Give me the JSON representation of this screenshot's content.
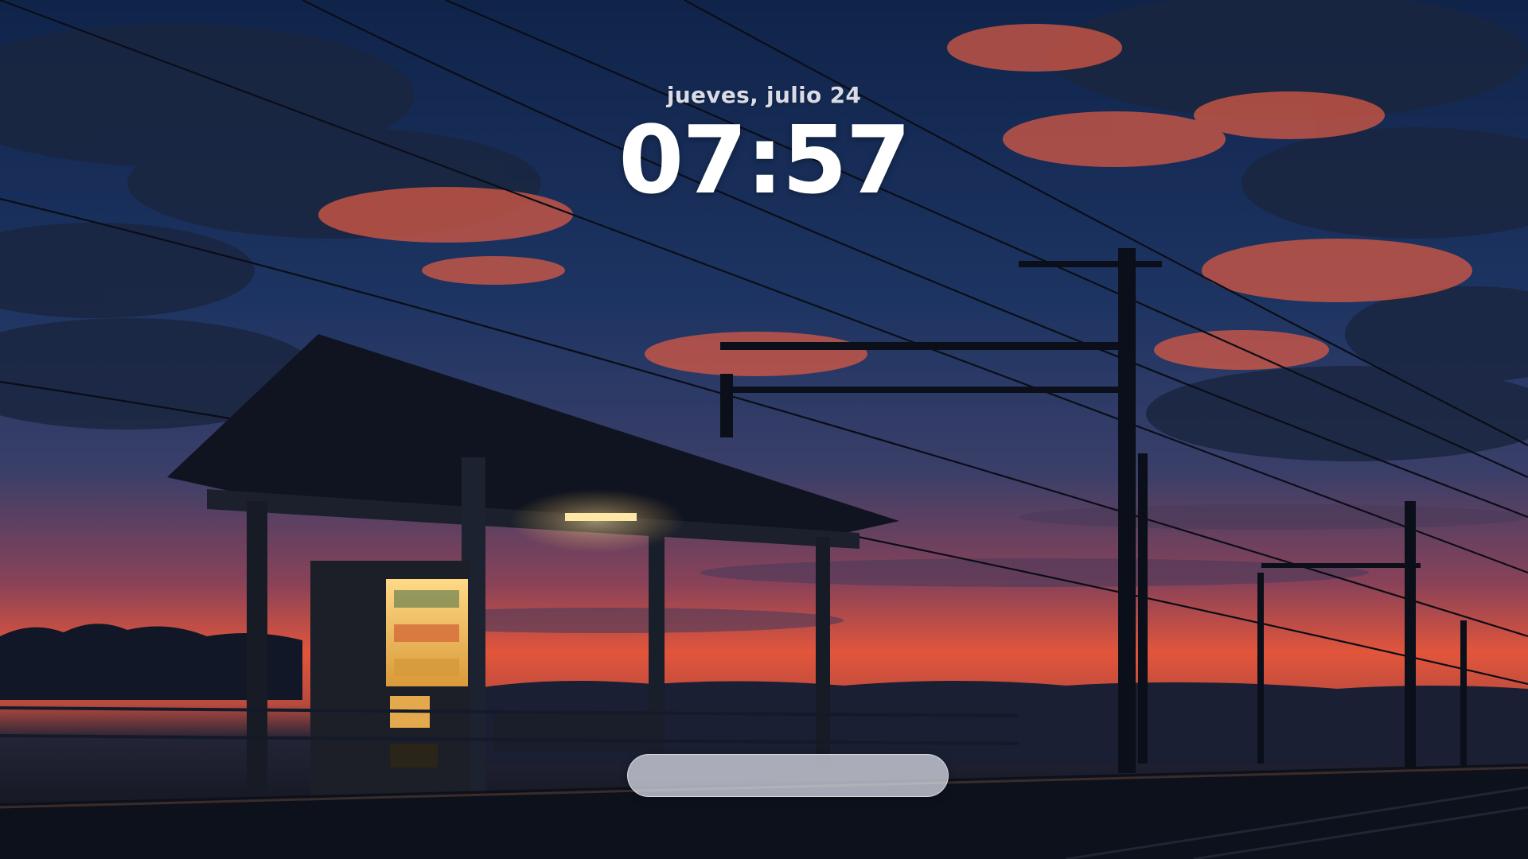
{
  "lockscreen": {
    "date": "jueves, julio 24",
    "time": "07:57",
    "password_placeholder": ""
  },
  "wallpaper": {
    "subject": "train-station-shelter-at-dusk",
    "colors": {
      "sky_top": "#13284d",
      "sky_mid": "#2b3f6c",
      "horizon_glow": "#e2553b",
      "cloud_glow": "#e0664a",
      "silhouette": "#0b0f1a",
      "lamp_glow": "#ffcf70"
    }
  }
}
